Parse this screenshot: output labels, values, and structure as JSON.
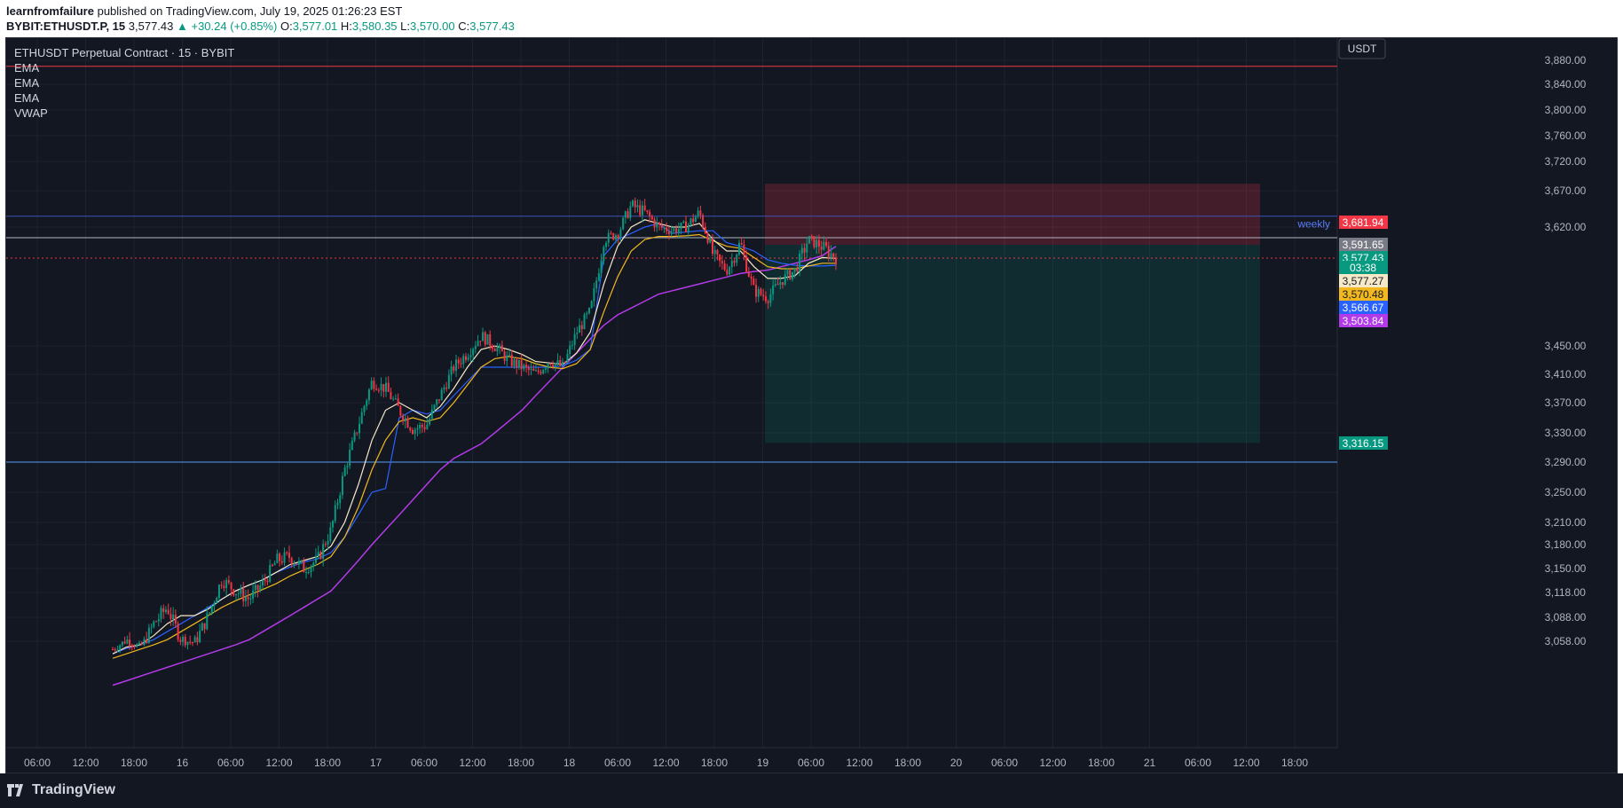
{
  "header": {
    "author": "learnfromfailure",
    "published": " published on TradingView.com, July 19, 2025 01:26:23 EST",
    "symbol": "BYBIT:ETHUSDT.P, 15",
    "last": "3,577.43",
    "change": "▲ +30.24 (+0.85%)",
    "o_label": "O:",
    "o": "3,577.01",
    "h_label": "H:",
    "h": "3,580.35",
    "l_label": "L:",
    "l": "3,570.00",
    "c_label": "C:",
    "c": "3,577.43"
  },
  "legend": {
    "title": "ETHUSDT Perpetual Contract · 15 · BYBIT",
    "items": [
      "EMA",
      "EMA",
      "EMA",
      "VWAP"
    ]
  },
  "currency_button": "USDT",
  "footer": {
    "brand": "TradingView"
  },
  "colors": {
    "background": "#131722",
    "grid": "#1e222d",
    "up": "#089981",
    "down": "#f23645",
    "ema_fast": "#f5e9c8",
    "ema_mid": "#f2b81f",
    "ema_slow": "#2962ff",
    "vwap": "#b33ae8",
    "risk_zone": "#f23645",
    "reward_zone": "#089981"
  },
  "chart_data": {
    "type": "candlestick",
    "symbol": "BYBIT:ETHUSDT.P",
    "timeframe": "15",
    "x_tick_labels": [
      "06:00",
      "12:00",
      "18:00",
      "16",
      "06:00",
      "12:00",
      "18:00",
      "17",
      "06:00",
      "12:00",
      "18:00",
      "18",
      "06:00",
      "12:00",
      "18:00",
      "19",
      "06:00",
      "12:00",
      "18:00",
      "20",
      "06:00",
      "12:00",
      "18:00",
      "21",
      "06:00",
      "12:00",
      "18:00"
    ],
    "y_tick_labels": [
      "3,880.00",
      "3,840.00",
      "3,800.00",
      "3,760.00",
      "3,720.00",
      "3,670.00",
      "3,620.00",
      "3,450.00",
      "3,410.00",
      "3,370.00",
      "3,330.00",
      "3,290.00",
      "3,250.00",
      "3,210.00",
      "3,180.00",
      "3,150.00",
      "3,118.00",
      "3,088.00",
      "3,058.00"
    ],
    "ylim": [
      3058,
      3880
    ],
    "horizontal_levels": [
      {
        "price": 3870,
        "color": "#f23645"
      },
      {
        "price": 3635,
        "color": "#3f51b5",
        "label": "weekly"
      },
      {
        "price": 3603,
        "color": "#b2b5be"
      },
      {
        "price": 3577.43,
        "color": "#f23645",
        "dotted": true
      },
      {
        "price": 3290,
        "color": "#5b9cf6"
      }
    ],
    "price_badges": [
      {
        "label": "3,681.94",
        "color": "#f23645"
      },
      {
        "label": "3,591.65",
        "color": "#787b86"
      },
      {
        "label": "3,577.43",
        "color": "#089981"
      },
      {
        "label": "03:38",
        "color": "#089981"
      },
      {
        "label": "3,577.27",
        "color": "#f5e9c8"
      },
      {
        "label": "3,570.48",
        "color": "#f2b81f"
      },
      {
        "label": "3,566.67",
        "color": "#2962ff"
      },
      {
        "label": "3,503.84",
        "color": "#b33ae8"
      },
      {
        "label": "3,316.15",
        "color": "#089981"
      }
    ],
    "position": {
      "entry": 3591.65,
      "stop": 3681.94,
      "target": 3316.15,
      "side": "short"
    },
    "series_anchors": {
      "close": [
        3040,
        3060,
        3045,
        3080,
        3100,
        3060,
        3055,
        3090,
        3135,
        3120,
        3110,
        3130,
        3160,
        3165,
        3150,
        3160,
        3200,
        3280,
        3340,
        3400,
        3390,
        3360,
        3335,
        3340,
        3380,
        3420,
        3440,
        3465,
        3450,
        3430,
        3420,
        3410,
        3430,
        3420,
        3470,
        3500,
        3600,
        3610,
        3650,
        3640,
        3620,
        3615,
        3620,
        3640,
        3580,
        3560,
        3595,
        3530,
        3520,
        3545,
        3560,
        3600,
        3590,
        3577
      ],
      "ema_fast": [
        3030,
        3045,
        3050,
        3065,
        3080,
        3090,
        3090,
        3098,
        3110,
        3120,
        3128,
        3135,
        3145,
        3155,
        3160,
        3165,
        3178,
        3210,
        3260,
        3320,
        3360,
        3370,
        3360,
        3350,
        3365,
        3390,
        3420,
        3445,
        3450,
        3445,
        3438,
        3428,
        3426,
        3424,
        3440,
        3470,
        3540,
        3590,
        3620,
        3630,
        3625,
        3620,
        3620,
        3625,
        3600,
        3585,
        3585,
        3565,
        3548,
        3548,
        3552,
        3570,
        3578,
        3577
      ],
      "ema_mid": [
        3020,
        3030,
        3040,
        3050,
        3060,
        3070,
        3080,
        3090,
        3100,
        3108,
        3115,
        3122,
        3130,
        3140,
        3148,
        3155,
        3165,
        3190,
        3230,
        3280,
        3320,
        3345,
        3350,
        3345,
        3350,
        3370,
        3395,
        3420,
        3432,
        3435,
        3432,
        3425,
        3420,
        3418,
        3425,
        3445,
        3500,
        3550,
        3585,
        3600,
        3605,
        3605,
        3606,
        3608,
        3598,
        3590,
        3588,
        3578,
        3565,
        3562,
        3562,
        3566,
        3570,
        3570
      ],
      "ema_slow": [
        3030,
        3042,
        3050,
        3060,
        3070,
        3080,
        3090,
        3100,
        3110,
        3120,
        3128,
        3135,
        3145,
        3152,
        3158,
        3162,
        3170,
        3190,
        3220,
        3250,
        3255,
        3350,
        3360,
        3355,
        3360,
        3380,
        3400,
        3420,
        3420,
        3420,
        3420,
        3420,
        3420,
        3422,
        3430,
        3445,
        3580,
        3600,
        3610,
        3620,
        3625,
        3610,
        3612,
        3614,
        3614,
        3595,
        3590,
        3585,
        3575,
        3570,
        3567,
        3566,
        3566,
        3567
      ],
      "vwap": [
        2960,
        2970,
        2980,
        2990,
        3000,
        3010,
        3020,
        3030,
        3040,
        3050,
        3060,
        3070,
        3080,
        3090,
        3100,
        3110,
        3120,
        3140,
        3160,
        3180,
        3200,
        3220,
        3240,
        3260,
        3280,
        3295,
        3305,
        3315,
        3330,
        3345,
        3360,
        3380,
        3400,
        3420,
        3440,
        3460,
        3480,
        3495,
        3505,
        3515,
        3525,
        3530,
        3535,
        3540,
        3545,
        3550,
        3555,
        3558,
        3560,
        3565,
        3570,
        3575,
        3580,
        3590
      ]
    }
  }
}
